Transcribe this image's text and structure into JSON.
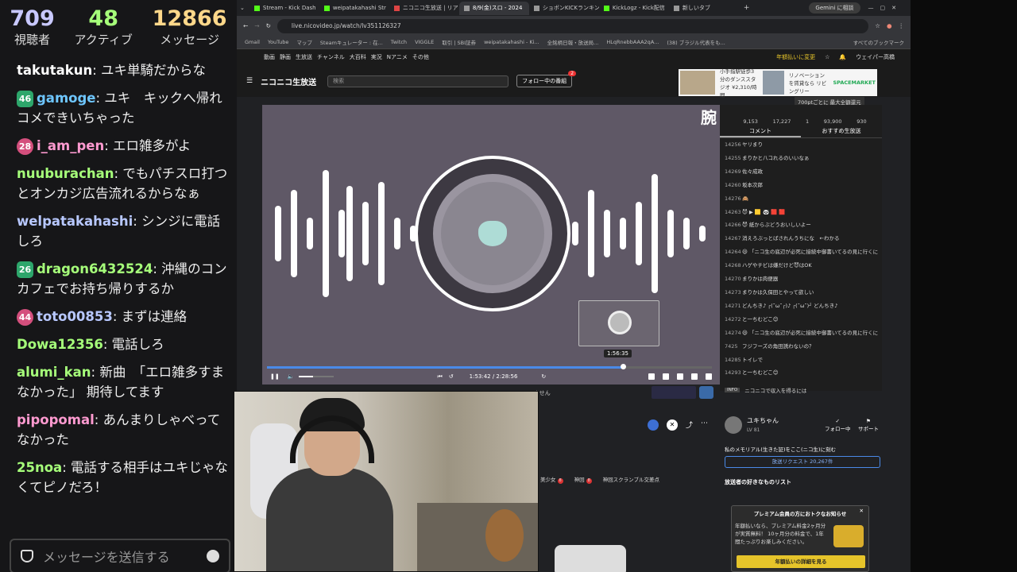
{
  "chat": {
    "stats": [
      {
        "num": "709",
        "label": "視聴者",
        "color": "#c8c8ff"
      },
      {
        "num": "48",
        "label": "アクティブ",
        "color": "#a6ff7a"
      },
      {
        "num": "12866",
        "label": "メッセージ",
        "color": "#ffd88a"
      }
    ],
    "messages": [
      {
        "user": "takutakun",
        "text": "ユキ単騎だからな",
        "color": "#ffffff",
        "badge": ""
      },
      {
        "user": "gamoge",
        "text": "ユキ　キックへ帰れコメできいちゃった",
        "color": "#6ec6ff",
        "badge": "46"
      },
      {
        "user": "i_am_pen",
        "text": "エロ雑多がよ",
        "color": "#ff9ad0",
        "badge": "28"
      },
      {
        "user": "nuuburachan",
        "text": "でもパチスロ打つとオンカジ広告流れるからなぁ",
        "color": "#a6ff7a",
        "badge": ""
      },
      {
        "user": "welpatakahashi",
        "text": "シンジに電話しろ",
        "color": "#b8c8ff",
        "badge": ""
      },
      {
        "user": "dragon6432524",
        "text": "沖縄のコンカフェでお持ち帰りするか",
        "color": "#a6ff7a",
        "badge": "26"
      },
      {
        "user": "toto00853",
        "text": "まずは連絡",
        "color": "#b8c8ff",
        "badge": "44"
      },
      {
        "user": "Dowa12356",
        "text": "電話しろ",
        "color": "#a6ff7a",
        "badge": ""
      },
      {
        "user": "alumi_kan",
        "text": "新曲　「エロ雑多すまなかった」 期待してます",
        "color": "#a6ff7a",
        "badge": ""
      },
      {
        "user": "pipopomal",
        "text": "あんまりしゃべってなかった",
        "color": "#ff9ad0",
        "badge": ""
      },
      {
        "user": "25noa",
        "text": "電話する相手はユキじゃなくてピノだろ！",
        "color": "#a6ff7a",
        "badge": ""
      }
    ],
    "input_placeholder": "メッセージを送信する"
  },
  "browser": {
    "tabs": [
      "Stream - Kick Dash",
      "weipatakahashi Str",
      "ニコニコ生放送 | リア",
      "8/9(金)スロ - 2024",
      "ショボンKICKランキン",
      "KickLogz - Kick配信",
      "新しいタブ"
    ],
    "gemini": "Gemini に相談",
    "url": "live.nicovideo.jp/watch/lv351126327",
    "bookmarks": [
      "Gmail",
      "YouTube",
      "マップ",
      "Steamキュレーター : 在...",
      "Twitch",
      "VIGGLE",
      "取引 | SBI証券",
      "weipatakahashi - Ki...",
      "全銘柄日報・放送局...",
      "HLqRnebbAAA2qA...",
      "(38) ブラジル代表をも..."
    ],
    "all_bookmarks": "すべてのブックマーク"
  },
  "nico": {
    "top_nav": [
      "動画",
      "静画",
      "生放送",
      "チャンネル",
      "大百科",
      "実況",
      "Nアニメ",
      "その他"
    ],
    "premium_link": "年額払いに変更",
    "user": "ウェイパー高橋",
    "logo": "ニコニコ生放送",
    "search_placeholder": "検索",
    "follow_btn": "フォロー中の番組",
    "follow_count": "2",
    "ad_text": "小手指駅徒歩3分のダンススタジオ ¥2,310/時間",
    "ad_text2": "リノベーションを賃貸なら リビングリー",
    "ad_brand": "SPACEMARKET",
    "ad_note": "700ptごとに 最大全額還元",
    "side_char": "腕",
    "seek_tooltip": "1:56:35",
    "time_display": "1:53:42 / 2:28:56",
    "stats": [
      "9,153",
      "17,227",
      "1",
      "93,900",
      "930"
    ],
    "panel_tabs": [
      "コメント",
      "おすすめ生放送"
    ],
    "comments": [
      {
        "n": "14256",
        "t": "ヤリまり"
      },
      {
        "n": "14255",
        "t": "まりかと八コれるのいいなぁ"
      },
      {
        "n": "14269",
        "t": "佐々成政"
      },
      {
        "n": "14260",
        "t": "坂本次郎"
      },
      {
        "n": "14276",
        "t": "🙈"
      },
      {
        "n": "14263",
        "t": "😈 ▶ 🟨 🐼 🟥 🟥"
      },
      {
        "n": "14266",
        "t": "😈 紙からぶどうおいしいよー"
      },
      {
        "n": "14267",
        "t": "消えろぶっとばされんうちにな　←わかる"
      },
      {
        "n": "14264",
        "t": "😃 「ニコ生の底辺が必死に接続中御書いてるの見に行くに"
      },
      {
        "n": "14268",
        "t": "ハゲやチビは嫌だけど😈はOK"
      },
      {
        "n": "14270",
        "t": "まりかは肉便器"
      },
      {
        "n": "14273",
        "t": "まりかは久保田とやって欲しい"
      },
      {
        "n": "14271",
        "t": "どんちき♪ ┌(˘ω˘┌)♪ ┌(˘ω˘)┘ どんちき♪"
      },
      {
        "n": "14272",
        "t": "と一ちむどこ😊"
      },
      {
        "n": "14274",
        "t": "😃 「ニコ生の底辺が必死に接続中御書いてるの見に行くに"
      },
      {
        "n": "7425",
        "t": "フジフーズの角田誘わないの？"
      },
      {
        "n": "14285",
        "t": "トイレで"
      },
      {
        "n": "14293",
        "t": "と一ちむどこ😊"
      }
    ],
    "info_tag": "INFO",
    "info_text": "ニコニコで収入を得るには",
    "cant_comment": "ません",
    "broadcaster": {
      "name": "ユキちゃん",
      "level": "LV 81",
      "follow": "フォロー中",
      "support": "サポート",
      "memorial": "私のメモリアル(生きた証)をここ(ニコ生)に刻む",
      "request": "放送リクエスト 20,267件"
    },
    "tags": [
      "美少女",
      "神回",
      "神回スクランブル交差点"
    ],
    "tag_counts": [
      "8",
      "8"
    ],
    "fav_list": "放送者の好きなものリスト",
    "premium": {
      "title": "プレミアム会員の方におトクなお知らせ",
      "body": "年額払いなら、プレミアム料金2ヶ月分が実質無料！ 10ヶ月分の料金で、1年間たっぷりお楽しみください。",
      "button": "年額払いの詳細を見る"
    }
  }
}
